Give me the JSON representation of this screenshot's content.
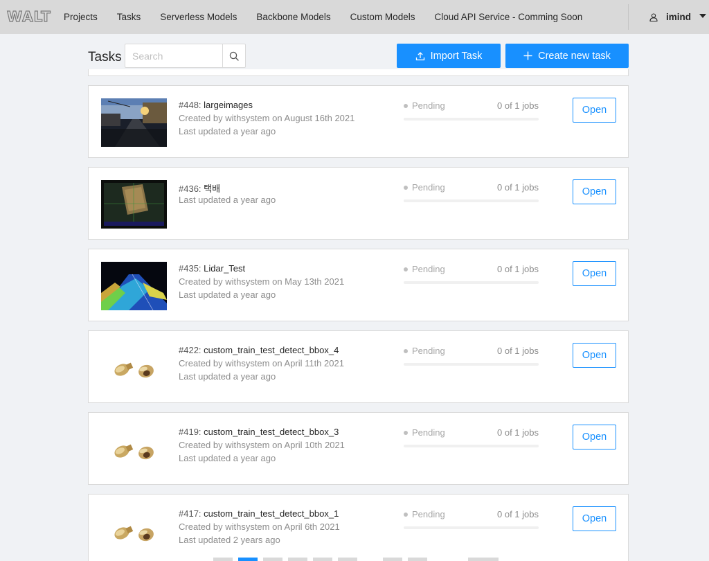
{
  "header": {
    "logo": "WALT",
    "nav": [
      "Projects",
      "Tasks",
      "Serverless Models",
      "Backbone Models",
      "Custom Models",
      "Cloud API Service - Comming Soon"
    ],
    "user": "imind",
    "icons": {
      "user": "user-icon",
      "caret": "caret-down-icon"
    }
  },
  "toolbar": {
    "title": "Tasks",
    "search_placeholder": "Search",
    "import_label": "Import Task",
    "create_label": "Create new task",
    "colors": {
      "primary": "#1890ff"
    }
  },
  "tasks": [
    {
      "id": "#448:",
      "name": "largeimages",
      "created": "Created by withsystem on August 16th 2021",
      "updated": "Last updated a year ago",
      "status": "Pending",
      "jobs": "0 of 1 jobs",
      "open": "Open",
      "progress": 0
    },
    {
      "id": "#436:",
      "name": "택배",
      "created": "",
      "updated": "Last updated a year ago",
      "status": "Pending",
      "jobs": "0 of 1 jobs",
      "open": "Open",
      "progress": 0
    },
    {
      "id": "#435:",
      "name": "Lidar_Test",
      "created": "Created by withsystem on May 13th 2021",
      "updated": "Last updated a year ago",
      "status": "Pending",
      "jobs": "0 of 1 jobs",
      "open": "Open",
      "progress": 0
    },
    {
      "id": "#422:",
      "name": "custom_train_test_detect_bbox_4",
      "created": "Created by withsystem on April 11th 2021",
      "updated": "Last updated a year ago",
      "status": "Pending",
      "jobs": "0 of 1 jobs",
      "open": "Open",
      "progress": 0
    },
    {
      "id": "#419:",
      "name": "custom_train_test_detect_bbox_3",
      "created": "Created by withsystem on April 10th 2021",
      "updated": "Last updated a year ago",
      "status": "Pending",
      "jobs": "0 of 1 jobs",
      "open": "Open",
      "progress": 0
    },
    {
      "id": "#417:",
      "name": "custom_train_test_detect_bbox_1",
      "created": "Created by withsystem on April 6th 2021",
      "updated": "Last updated 2 years ago",
      "status": "Pending",
      "jobs": "0 of 1 jobs",
      "open": "Open",
      "progress": 0
    }
  ]
}
